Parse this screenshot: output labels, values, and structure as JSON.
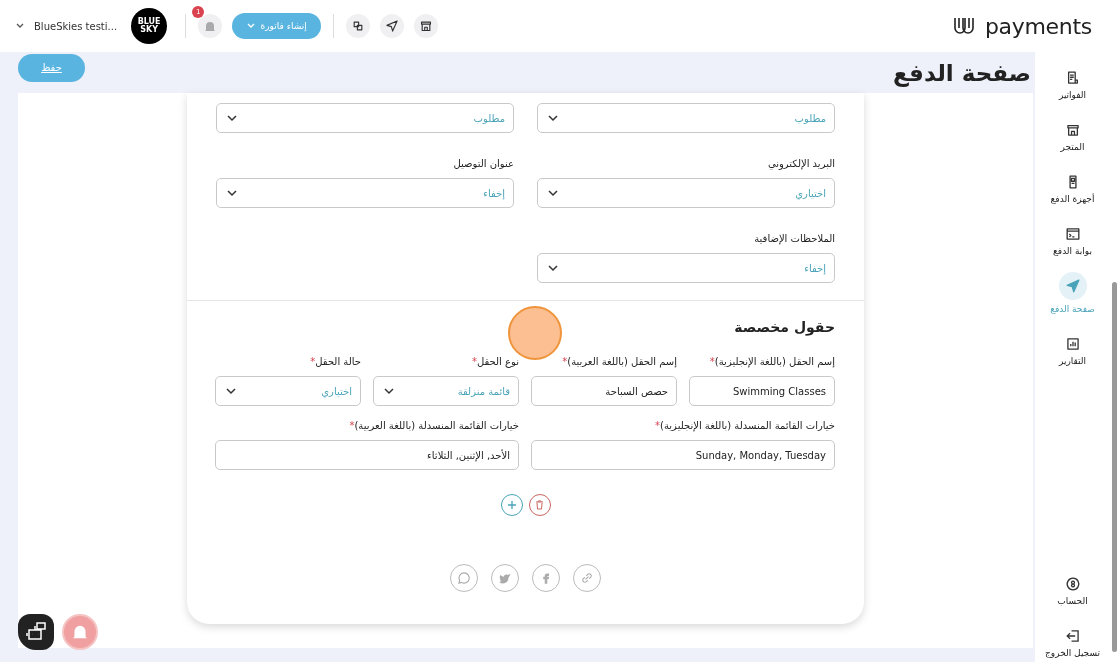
{
  "topbar": {
    "logo": "payments",
    "account": "BlueSkies testi...",
    "avatar": "BLUE SKY",
    "notifications": "1",
    "create_invoice": "إنشاء فاتورة",
    "quick_icons": [
      {
        "kind": "exchange"
      },
      {
        "kind": "send"
      },
      {
        "kind": "store"
      }
    ]
  },
  "page": {
    "title": "صفحة الدفع",
    "save": "حفظ"
  },
  "settings": [
    {
      "value": "مطلوب"
    },
    {
      "value": "مطلوب"
    },
    {
      "label": "البريد الإلكتروني",
      "value": "اختياري"
    },
    {
      "label": "عنوان التوصيل",
      "value": "إخفاء"
    },
    {
      "label": "الملاحظات الإضافية",
      "value": "إخفاء"
    }
  ],
  "custom_fields": {
    "title": "حقول مخصصة",
    "required_mark": "*",
    "fields": [
      {
        "kind": "input",
        "label": "إسم الحقل (باللغة الإنجليزية)",
        "required": true,
        "value": "Swimming Classes",
        "wide": false
      },
      {
        "kind": "input",
        "label": "إسم الحقل (باللغة العربية)",
        "required": true,
        "value": "حصص السباحة",
        "wide": false
      },
      {
        "kind": "select",
        "label": "نوع الحقل",
        "required": true,
        "value": "قائمة منزلقة",
        "wide": false
      },
      {
        "kind": "select",
        "label": "حالة الحقل",
        "required": true,
        "value": "اختياري",
        "wide": false
      },
      {
        "kind": "input",
        "label": "خيارات القائمة المنسدلة (باللغة الإنجليزية)",
        "required": true,
        "value": "Sunday, Monday, Tuesday",
        "wide": true
      },
      {
        "kind": "input",
        "label": "خيارات القائمة المنسدلة (باللغة العربية)",
        "required": true,
        "value": "الأحد, الإثنين, الثلاثاء",
        "wide": true
      }
    ]
  },
  "share": [
    {
      "kind": "whatsapp"
    },
    {
      "kind": "twitter"
    },
    {
      "kind": "facebook"
    },
    {
      "kind": "link"
    }
  ],
  "sidebar": {
    "items": [
      {
        "kind": "invoice",
        "label": "الفواتير",
        "selected": false
      },
      {
        "kind": "store",
        "label": "المتجر",
        "selected": false
      },
      {
        "kind": "device",
        "label": "أجهزة الدفع",
        "selected": false
      },
      {
        "kind": "gateway",
        "label": "بوابة الدفع",
        "selected": false
      },
      {
        "kind": "send",
        "label": "صفحة الدفع",
        "selected": true
      },
      {
        "kind": "reports",
        "label": "التقارير",
        "selected": false
      }
    ],
    "bottom": [
      {
        "kind": "account",
        "label": "الحساب",
        "selected": false
      },
      {
        "kind": "logout",
        "label": "تسجيل الخروج",
        "selected": false
      }
    ]
  }
}
